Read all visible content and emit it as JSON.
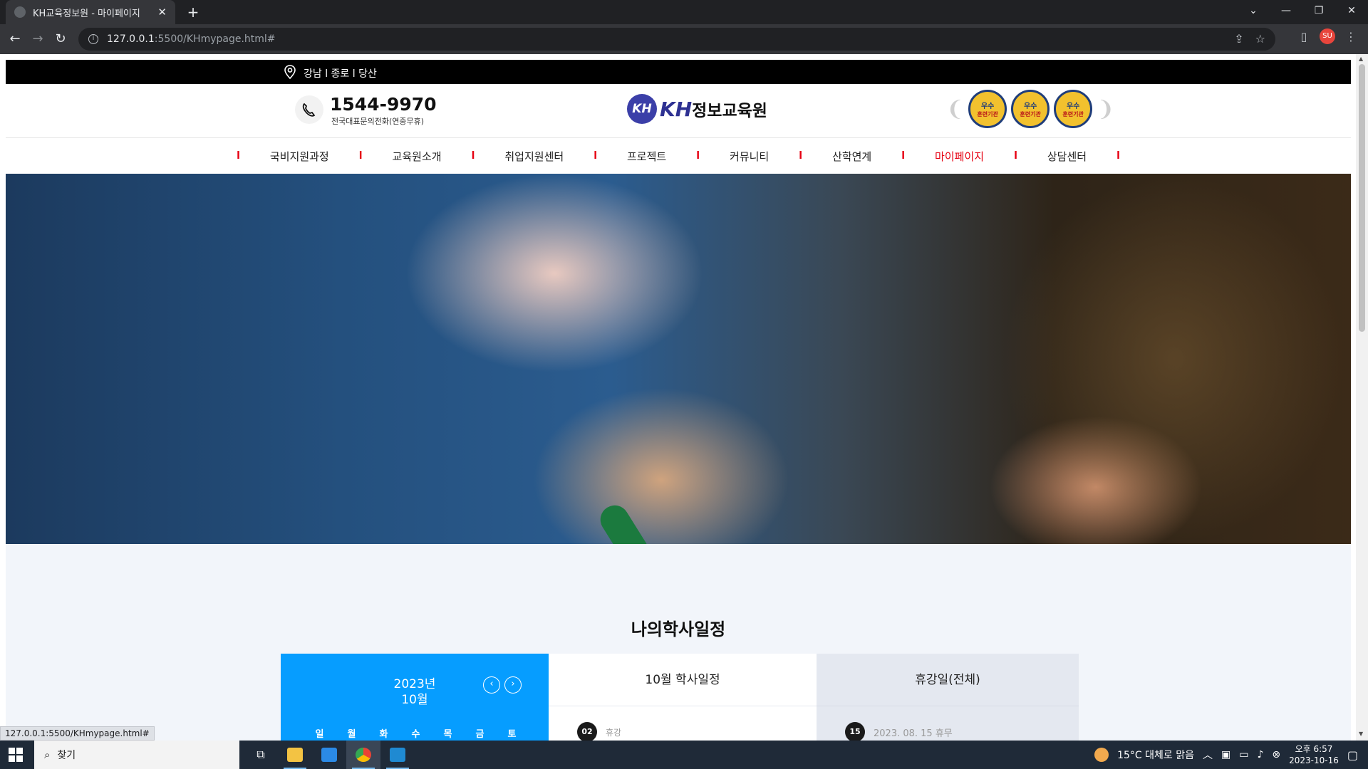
{
  "browser": {
    "tab_title": "KH교육정보원 - 마이페이지",
    "url_host": "127.0.0.1",
    "url_path": ":5500/KHmypage.html#",
    "status_url": "127.0.0.1:5500/KHmypage.html#",
    "profile_initials": "SU"
  },
  "site": {
    "topbar": {
      "locations": "강남 l 종로 l 당산"
    },
    "header": {
      "phone": "1544-9970",
      "phone_sub": "전국대표문의전화(연중무휴)",
      "logo_mark": "KH",
      "logo_kh": "KH",
      "logo_text": "정보교육원",
      "badges": [
        {
          "top": "우수",
          "bottom": "훈련기관"
        },
        {
          "top": "우수",
          "bottom": "훈련기관"
        },
        {
          "top": "우수",
          "bottom": "훈련기관"
        }
      ]
    },
    "gnb": [
      {
        "label": "국비지원과정",
        "active": false
      },
      {
        "label": "교육원소개",
        "active": false
      },
      {
        "label": "취업지원센터",
        "active": false
      },
      {
        "label": "프로젝트",
        "active": false
      },
      {
        "label": "커뮤니티",
        "active": false
      },
      {
        "label": "산학연계",
        "active": false
      },
      {
        "label": "마이페이지",
        "active": true
      },
      {
        "label": "상담센터",
        "active": false
      }
    ],
    "gnb_separator": "l",
    "schedule": {
      "title": "나의학사일정",
      "calendar": {
        "year": "2023년",
        "month": "10월",
        "weekdays": [
          "일",
          "월",
          "화",
          "수",
          "목",
          "금",
          "토"
        ]
      },
      "academic": {
        "heading": "10월 학사일정",
        "items": [
          {
            "day": "02",
            "text": "휴강"
          }
        ]
      },
      "holidays": {
        "heading": "휴강일(전체)",
        "items": [
          {
            "day": "15",
            "text": "2023. 08. 15 휴무"
          }
        ]
      }
    }
  },
  "taskbar": {
    "search_placeholder": "찾기",
    "weather": "15°C  대체로 맑음",
    "time": "오후 6:57",
    "date": "2023-10-16"
  },
  "colors": {
    "accent_red": "#e60012",
    "calendar_blue": "#069dff",
    "logo_navy": "#2e3192"
  }
}
